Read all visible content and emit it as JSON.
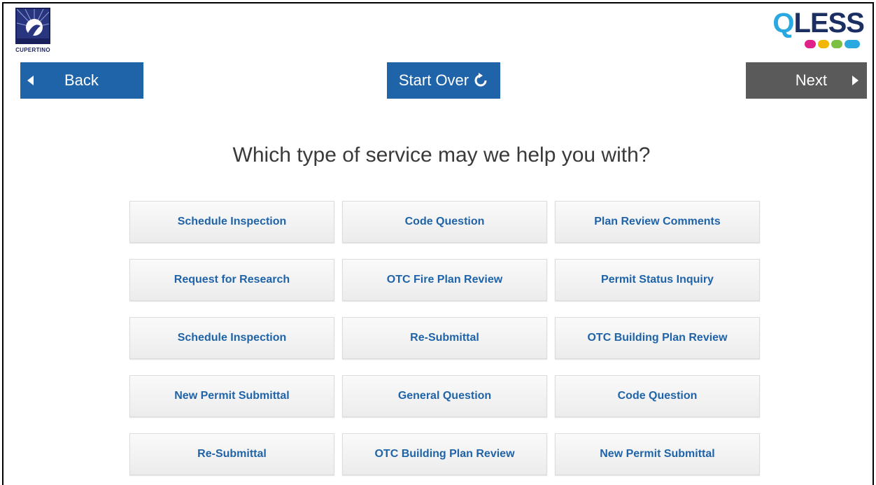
{
  "header": {
    "city_logo_text": "CUPERTINO",
    "brand_logo_text": "QLESS",
    "brand_dot_colors": [
      "#e0218a",
      "#f2b705",
      "#7bc043",
      "#2aa8e0"
    ]
  },
  "nav": {
    "back_label": "Back",
    "start_over_label": "Start Over",
    "next_label": "Next"
  },
  "colors": {
    "primary": "#1f63a8",
    "next_disabled": "#5a5a5a"
  },
  "main": {
    "question": "Which type of service may we help you with?",
    "services": [
      "Schedule Inspection",
      "Code Question",
      "Plan Review Comments",
      "Request for Research",
      "OTC Fire Plan Review",
      "Permit Status Inquiry",
      "Schedule Inspection",
      "Re-Submittal",
      "OTC Building Plan Review",
      "New Permit Submittal",
      "General Question",
      "Code Question",
      "Re-Submittal",
      "OTC Building Plan Review",
      "New Permit Submittal"
    ]
  }
}
